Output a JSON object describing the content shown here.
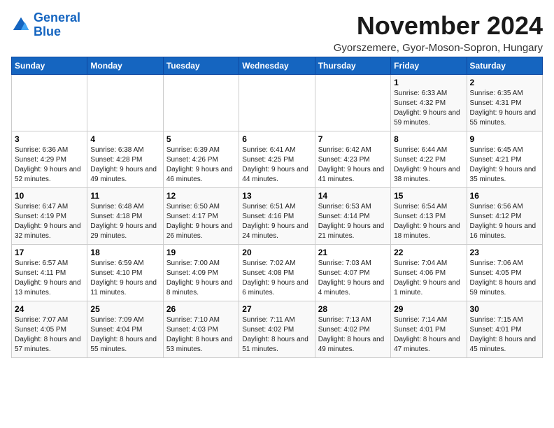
{
  "logo": {
    "line1": "General",
    "line2": "Blue"
  },
  "calendar": {
    "title": "November 2024",
    "subtitle": "Gyorszemere, Gyor-Moson-Sopron, Hungary",
    "days_of_week": [
      "Sunday",
      "Monday",
      "Tuesday",
      "Wednesday",
      "Thursday",
      "Friday",
      "Saturday"
    ],
    "weeks": [
      [
        {
          "day": "",
          "info": ""
        },
        {
          "day": "",
          "info": ""
        },
        {
          "day": "",
          "info": ""
        },
        {
          "day": "",
          "info": ""
        },
        {
          "day": "",
          "info": ""
        },
        {
          "day": "1",
          "info": "Sunrise: 6:33 AM\nSunset: 4:32 PM\nDaylight: 9 hours and 59 minutes."
        },
        {
          "day": "2",
          "info": "Sunrise: 6:35 AM\nSunset: 4:31 PM\nDaylight: 9 hours and 55 minutes."
        }
      ],
      [
        {
          "day": "3",
          "info": "Sunrise: 6:36 AM\nSunset: 4:29 PM\nDaylight: 9 hours and 52 minutes."
        },
        {
          "day": "4",
          "info": "Sunrise: 6:38 AM\nSunset: 4:28 PM\nDaylight: 9 hours and 49 minutes."
        },
        {
          "day": "5",
          "info": "Sunrise: 6:39 AM\nSunset: 4:26 PM\nDaylight: 9 hours and 46 minutes."
        },
        {
          "day": "6",
          "info": "Sunrise: 6:41 AM\nSunset: 4:25 PM\nDaylight: 9 hours and 44 minutes."
        },
        {
          "day": "7",
          "info": "Sunrise: 6:42 AM\nSunset: 4:23 PM\nDaylight: 9 hours and 41 minutes."
        },
        {
          "day": "8",
          "info": "Sunrise: 6:44 AM\nSunset: 4:22 PM\nDaylight: 9 hours and 38 minutes."
        },
        {
          "day": "9",
          "info": "Sunrise: 6:45 AM\nSunset: 4:21 PM\nDaylight: 9 hours and 35 minutes."
        }
      ],
      [
        {
          "day": "10",
          "info": "Sunrise: 6:47 AM\nSunset: 4:19 PM\nDaylight: 9 hours and 32 minutes."
        },
        {
          "day": "11",
          "info": "Sunrise: 6:48 AM\nSunset: 4:18 PM\nDaylight: 9 hours and 29 minutes."
        },
        {
          "day": "12",
          "info": "Sunrise: 6:50 AM\nSunset: 4:17 PM\nDaylight: 9 hours and 26 minutes."
        },
        {
          "day": "13",
          "info": "Sunrise: 6:51 AM\nSunset: 4:16 PM\nDaylight: 9 hours and 24 minutes."
        },
        {
          "day": "14",
          "info": "Sunrise: 6:53 AM\nSunset: 4:14 PM\nDaylight: 9 hours and 21 minutes."
        },
        {
          "day": "15",
          "info": "Sunrise: 6:54 AM\nSunset: 4:13 PM\nDaylight: 9 hours and 18 minutes."
        },
        {
          "day": "16",
          "info": "Sunrise: 6:56 AM\nSunset: 4:12 PM\nDaylight: 9 hours and 16 minutes."
        }
      ],
      [
        {
          "day": "17",
          "info": "Sunrise: 6:57 AM\nSunset: 4:11 PM\nDaylight: 9 hours and 13 minutes."
        },
        {
          "day": "18",
          "info": "Sunrise: 6:59 AM\nSunset: 4:10 PM\nDaylight: 9 hours and 11 minutes."
        },
        {
          "day": "19",
          "info": "Sunrise: 7:00 AM\nSunset: 4:09 PM\nDaylight: 9 hours and 8 minutes."
        },
        {
          "day": "20",
          "info": "Sunrise: 7:02 AM\nSunset: 4:08 PM\nDaylight: 9 hours and 6 minutes."
        },
        {
          "day": "21",
          "info": "Sunrise: 7:03 AM\nSunset: 4:07 PM\nDaylight: 9 hours and 4 minutes."
        },
        {
          "day": "22",
          "info": "Sunrise: 7:04 AM\nSunset: 4:06 PM\nDaylight: 9 hours and 1 minute."
        },
        {
          "day": "23",
          "info": "Sunrise: 7:06 AM\nSunset: 4:05 PM\nDaylight: 8 hours and 59 minutes."
        }
      ],
      [
        {
          "day": "24",
          "info": "Sunrise: 7:07 AM\nSunset: 4:05 PM\nDaylight: 8 hours and 57 minutes."
        },
        {
          "day": "25",
          "info": "Sunrise: 7:09 AM\nSunset: 4:04 PM\nDaylight: 8 hours and 55 minutes."
        },
        {
          "day": "26",
          "info": "Sunrise: 7:10 AM\nSunset: 4:03 PM\nDaylight: 8 hours and 53 minutes."
        },
        {
          "day": "27",
          "info": "Sunrise: 7:11 AM\nSunset: 4:02 PM\nDaylight: 8 hours and 51 minutes."
        },
        {
          "day": "28",
          "info": "Sunrise: 7:13 AM\nSunset: 4:02 PM\nDaylight: 8 hours and 49 minutes."
        },
        {
          "day": "29",
          "info": "Sunrise: 7:14 AM\nSunset: 4:01 PM\nDaylight: 8 hours and 47 minutes."
        },
        {
          "day": "30",
          "info": "Sunrise: 7:15 AM\nSunset: 4:01 PM\nDaylight: 8 hours and 45 minutes."
        }
      ]
    ]
  }
}
